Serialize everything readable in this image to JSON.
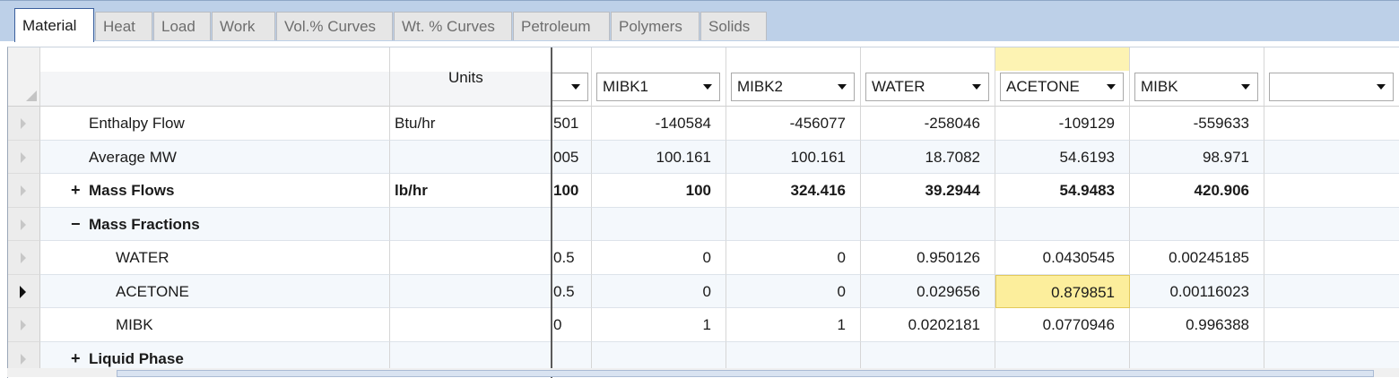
{
  "tabs": [
    "Material",
    "Heat",
    "Load",
    "Work",
    "Vol.% Curves",
    "Wt. % Curves",
    "Petroleum",
    "Polymers",
    "Solids"
  ],
  "active_tab": "Material",
  "grid": {
    "units_header": "Units",
    "columns": [
      "",
      "MIBK1",
      "MIBK2",
      "WATER",
      "ACETONE",
      "MIBK",
      ""
    ],
    "selected_column": "ACETONE",
    "rows": [
      {
        "label": "Enthalpy Flow",
        "units": "Btu/hr",
        "expander": "",
        "bold": false,
        "values": [
          "501",
          "-140584",
          "-456077",
          "-258046",
          "-109129",
          "-559633",
          ""
        ]
      },
      {
        "label": "Average MW",
        "units": "",
        "expander": "",
        "bold": false,
        "values": [
          "005",
          "100.161",
          "100.161",
          "18.7082",
          "54.6193",
          "98.971",
          ""
        ]
      },
      {
        "label": "Mass Flows",
        "units": "lb/hr",
        "expander": "+",
        "bold": true,
        "values": [
          "100",
          "100",
          "324.416",
          "39.2944",
          "54.9483",
          "420.906",
          ""
        ]
      },
      {
        "label": "Mass Fractions",
        "units": "",
        "expander": "−",
        "bold": true,
        "values": [
          "",
          "",
          "",
          "",
          "",
          "",
          ""
        ]
      },
      {
        "label": "WATER",
        "units": "",
        "expander": "",
        "bold": false,
        "indent": true,
        "values": [
          "0.5",
          "0",
          "0",
          "0.950126",
          "0.0430545",
          "0.00245185",
          ""
        ]
      },
      {
        "label": "ACETONE",
        "units": "",
        "expander": "",
        "bold": false,
        "indent": true,
        "current": true,
        "values": [
          "0.5",
          "0",
          "0",
          "0.029656",
          "0.879851",
          "0.00116023",
          ""
        ]
      },
      {
        "label": "MIBK",
        "units": "",
        "expander": "",
        "bold": false,
        "indent": true,
        "values": [
          "0",
          "1",
          "1",
          "0.0202181",
          "0.0770946",
          "0.996388",
          ""
        ]
      },
      {
        "label": "Liquid Phase",
        "units": "",
        "expander": "+",
        "bold": true,
        "values": [
          "",
          "",
          "",
          "",
          "",
          "",
          ""
        ]
      }
    ]
  },
  "colors": {
    "tabbar": "#bdd0e8",
    "selected_cell": "#fcee9c",
    "alt_row": "#f4f8fc"
  }
}
